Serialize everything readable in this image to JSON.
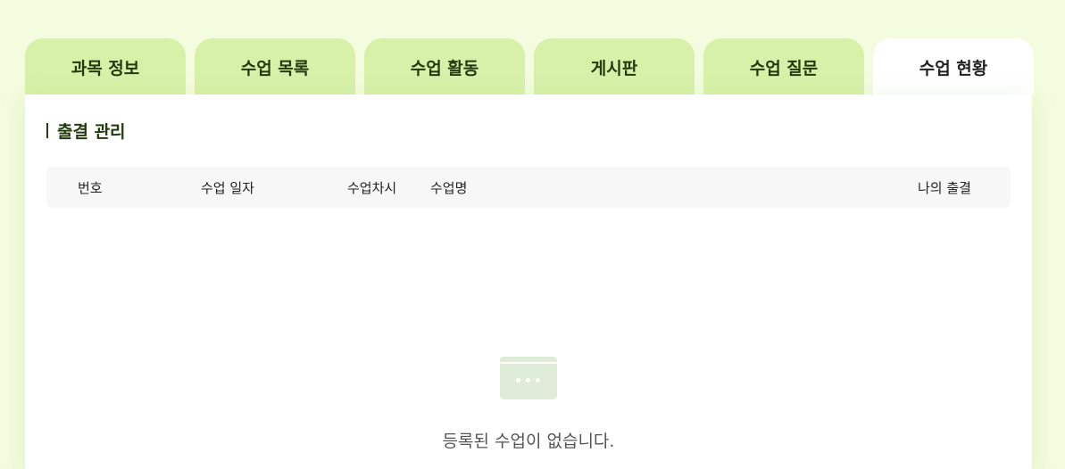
{
  "tabs": [
    {
      "label": "과목 정보",
      "active": false
    },
    {
      "label": "수업 목록",
      "active": false
    },
    {
      "label": "수업 활동",
      "active": false
    },
    {
      "label": "게시판",
      "active": false
    },
    {
      "label": "수업 질문",
      "active": false
    },
    {
      "label": "수업 현황",
      "active": true
    }
  ],
  "section": {
    "title": "출결 관리"
  },
  "table": {
    "columns": [
      "번호",
      "수업 일자",
      "수업차시",
      "수업명",
      "나의 출결"
    ]
  },
  "empty_state": {
    "icon": "empty-window-icon",
    "message": "등록된 수업이 없습니다."
  },
  "colors": {
    "page_background": "#f3fcde",
    "tab_inactive": "#d7f1a9",
    "tab_active": "#ffffff",
    "text_dark_green": "#243b10",
    "empty_icon": "#dfedd8"
  }
}
